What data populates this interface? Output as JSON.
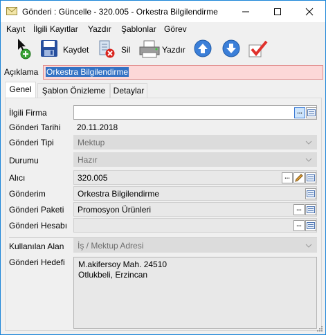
{
  "window": {
    "title": "Gönderi : Güncelle - 320.005 - Orkestra Bilgilendirme"
  },
  "menu": [
    "Kayıt",
    "İlgili Kayıtlar",
    "Yazdır",
    "Şablonlar",
    "Görev"
  ],
  "toolbar": {
    "save_label": "Kaydet",
    "delete_label": "Sil",
    "print_label": "Yazdır"
  },
  "aciklama": {
    "label": "Açıklama",
    "value": "Orkestra Bilgilendirme"
  },
  "tabs": [
    "Genel",
    "Şablon Önizleme",
    "Detaylar"
  ],
  "form": {
    "ilgili_firma": {
      "label": "İlgili Firma",
      "value": ""
    },
    "gonderi_tarihi": {
      "label": "Gönderi Tarihi",
      "value": "20.11.2018"
    },
    "gonderi_tipi": {
      "label": "Gönderi Tipi",
      "value": "Mektup"
    },
    "durumu": {
      "label": "Durumu",
      "value": "Hazır"
    },
    "alici": {
      "label": "Alıcı",
      "value": "320.005"
    },
    "gonderim": {
      "label": "Gönderim",
      "value": "Orkestra Bilgilendirme"
    },
    "gonderi_paketi": {
      "label": "Gönderi Paketi",
      "value": "Promosyon Ürünleri"
    },
    "gonderi_hesabi": {
      "label": "Gönderi Hesabı",
      "value": ""
    },
    "kullanilan_alan": {
      "label": "Kullanılan Alan",
      "value": "İş / Mektup Adresi"
    },
    "gonderi_hedefi": {
      "label": "Gönderi Hedefi",
      "lines": [
        "M.akifersoy Mah. 24510",
        "Otlukbeli, Erzincan"
      ]
    }
  },
  "icons": [
    "envelope-icon",
    "minimize-icon",
    "maximize-icon",
    "close-icon",
    "new-record-icon",
    "save-icon",
    "delete-icon",
    "print-icon",
    "up-arrow-icon",
    "down-arrow-icon",
    "approve-icon"
  ],
  "colors": {
    "accent": "#1883d7",
    "required_field": "#fcd8d8",
    "selection": "#3372c4"
  }
}
